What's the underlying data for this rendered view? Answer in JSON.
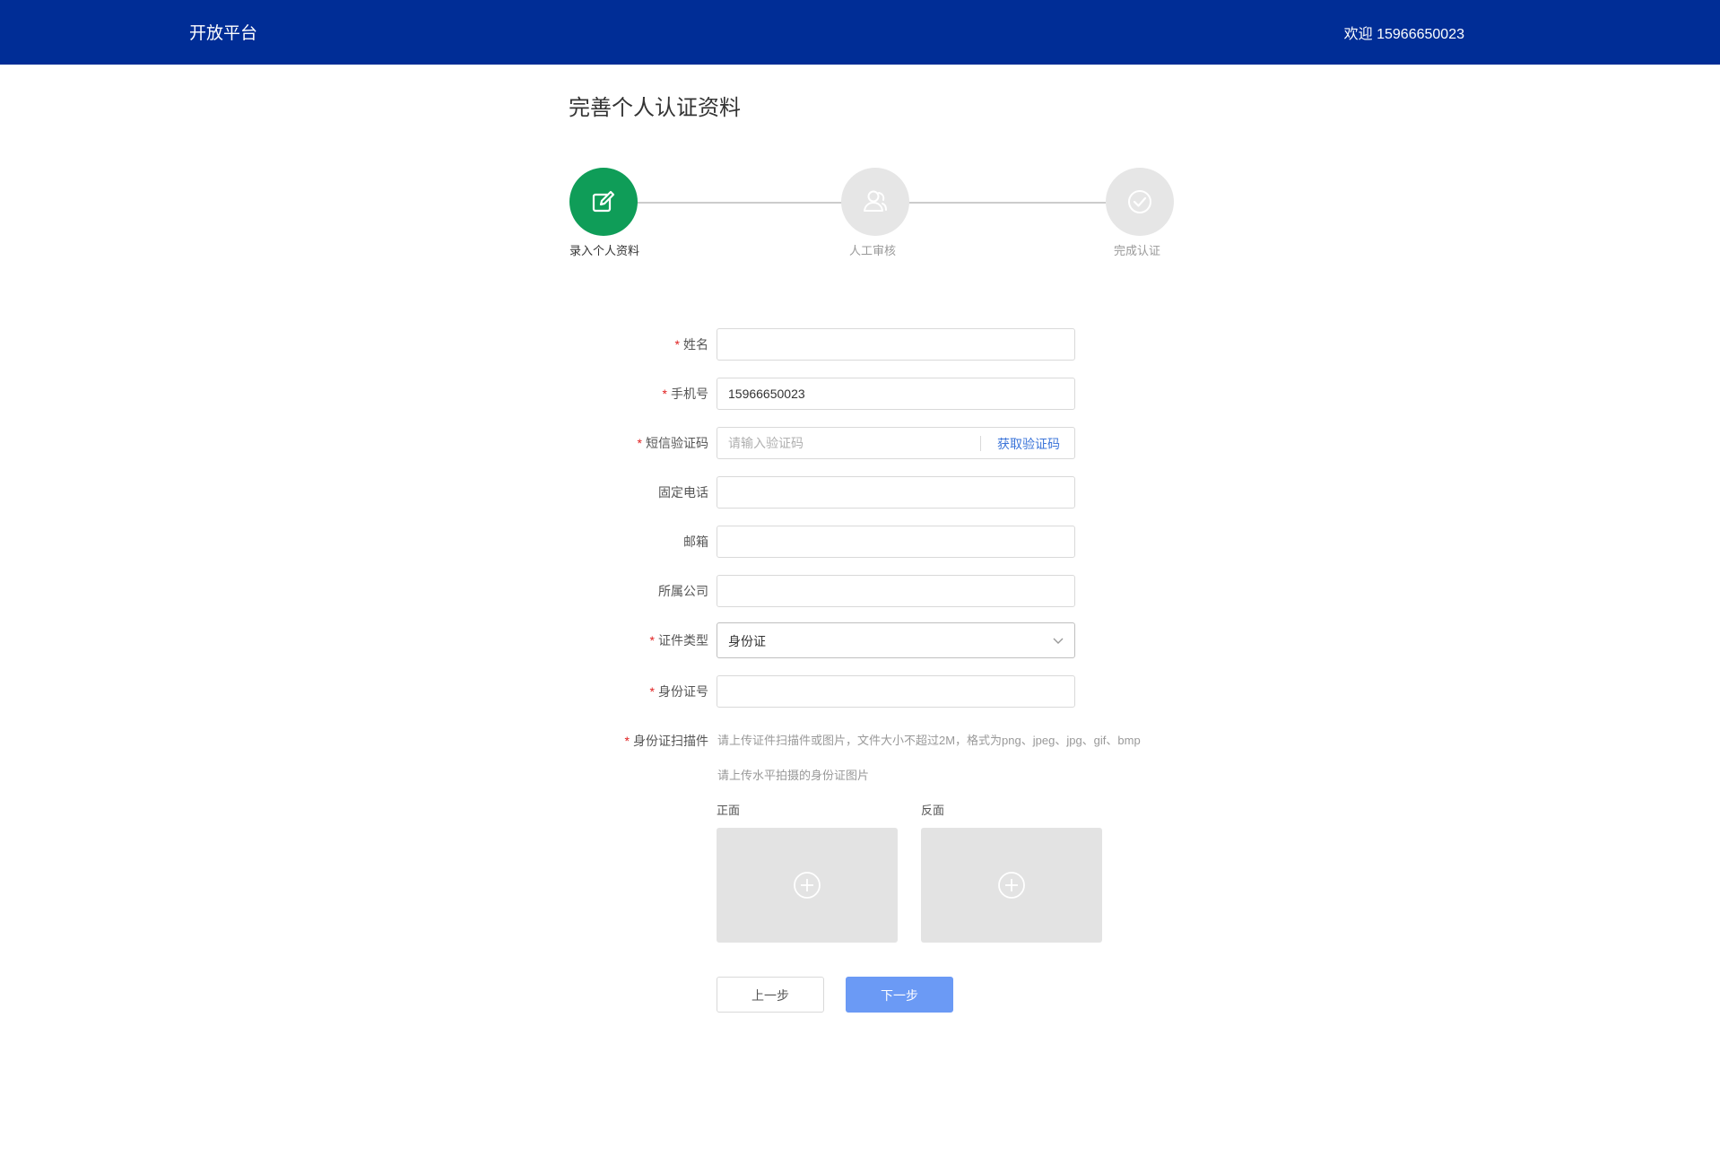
{
  "header": {
    "brand": "开放平台",
    "welcome": "欢迎 15966650023"
  },
  "page": {
    "title": "完善个人认证资料"
  },
  "steps": [
    {
      "label": "录入个人资料",
      "icon": "edit-icon",
      "active": true
    },
    {
      "label": "人工审核",
      "icon": "person-review-icon",
      "active": false
    },
    {
      "label": "完成认证",
      "icon": "check-circle-icon",
      "active": false
    }
  ],
  "form": {
    "name": {
      "label": "姓名",
      "required": "*",
      "value": ""
    },
    "phone": {
      "label": "手机号",
      "required": "*",
      "value": "15966650023"
    },
    "sms": {
      "label": "短信验证码",
      "required": "*",
      "placeholder": "请输入验证码",
      "button": "获取验证码"
    },
    "landline": {
      "label": "固定电话",
      "value": ""
    },
    "email": {
      "label": "邮箱",
      "value": ""
    },
    "company": {
      "label": "所属公司",
      "value": ""
    },
    "id_type": {
      "label": "证件类型",
      "required": "*",
      "value": "身份证"
    },
    "id_number": {
      "label": "身份证号",
      "required": "*",
      "value": ""
    },
    "id_scan": {
      "label": "身份证扫描件",
      "required": "*",
      "hint1": "请上传证件扫描件或图片，文件大小不超过2M，格式为png、jpeg、jpg、gif、bmp",
      "hint2": "请上传水平拍摄的身份证图片",
      "front_label": "正面",
      "back_label": "反面"
    }
  },
  "actions": {
    "prev": "上一步",
    "next": "下一步"
  },
  "colors": {
    "header_bg": "#002d96",
    "active_step": "#0f9d58",
    "inactive_step": "#e6e6e6",
    "link": "#3b74d9",
    "primary_button": "#6b9af5",
    "required": "#e02020"
  }
}
